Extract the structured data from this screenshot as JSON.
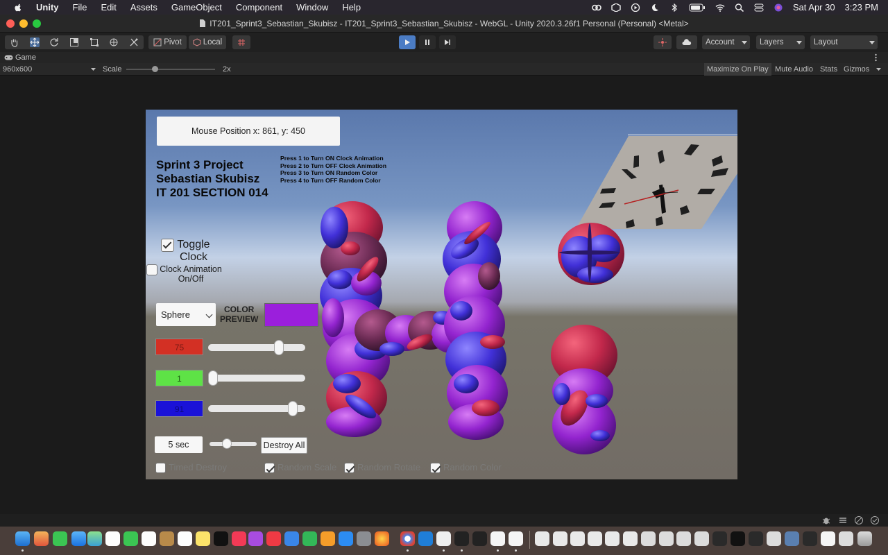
{
  "menubar": {
    "app": "Unity",
    "items": [
      "File",
      "Edit",
      "Assets",
      "GameObject",
      "Component",
      "Window",
      "Help"
    ],
    "date": "Sat Apr 30",
    "time": "3:23 PM"
  },
  "window": {
    "title": "IT201_Sprint3_Sebastian_Skubisz - IT201_Sprint3_Sebastian_Skubisz - WebGL - Unity 2020.3.26f1 Personal (Personal) <Metal>"
  },
  "toolbar": {
    "pivot": "Pivot",
    "local": "Local",
    "account": "Account",
    "layers": "Layers",
    "layout": "Layout"
  },
  "gameview": {
    "tab": "Game",
    "resolution": "960x600",
    "scale_label": "Scale",
    "scale_value": "2x",
    "maximize": "Maximize On Play",
    "mute": "Mute Audio",
    "stats": "Stats",
    "gizmos": "Gizmos"
  },
  "game": {
    "mouse_position": "Mouse Position x: 861, y: 450",
    "title_lines": [
      "Sprint 3 Project",
      "Sebastian Skubisz",
      "IT 201 SECTION 014"
    ],
    "instructions": [
      "Press 1 to Turn ON Clock Animation",
      "Press 2 to Turn OFF Clock Animation",
      "Press 3 to Turn ON Random Color",
      "Press 4 to Turn OFF Random Color"
    ],
    "toggle_clock": {
      "line1": "Toggle",
      "line2": "Clock",
      "checked": true
    },
    "clock_anim": {
      "line1": "Clock Animation",
      "line2": "On/Off",
      "checked": false
    },
    "shape": "Sphere",
    "color_preview_l1": "COLOR",
    "color_preview_l2": "PREVIEW",
    "preview_color": "#9b1fdc",
    "red": {
      "value": "75",
      "fraction": 0.75,
      "color": "#d33024"
    },
    "green": {
      "value": "1",
      "fraction": 0.0,
      "color": "#5ee246"
    },
    "blue": {
      "value": "91",
      "fraction": 0.91,
      "color": "#1a12d8"
    },
    "timer": "5 sec",
    "timer_fraction": 0.33,
    "destroy_all": "Destroy All",
    "bottom": [
      {
        "label": "Timed Destroy",
        "checked": false
      },
      {
        "label": "Random Scale",
        "checked": true
      },
      {
        "label": "Random Rotate",
        "checked": true
      },
      {
        "label": "Random Color",
        "checked": true
      }
    ]
  }
}
